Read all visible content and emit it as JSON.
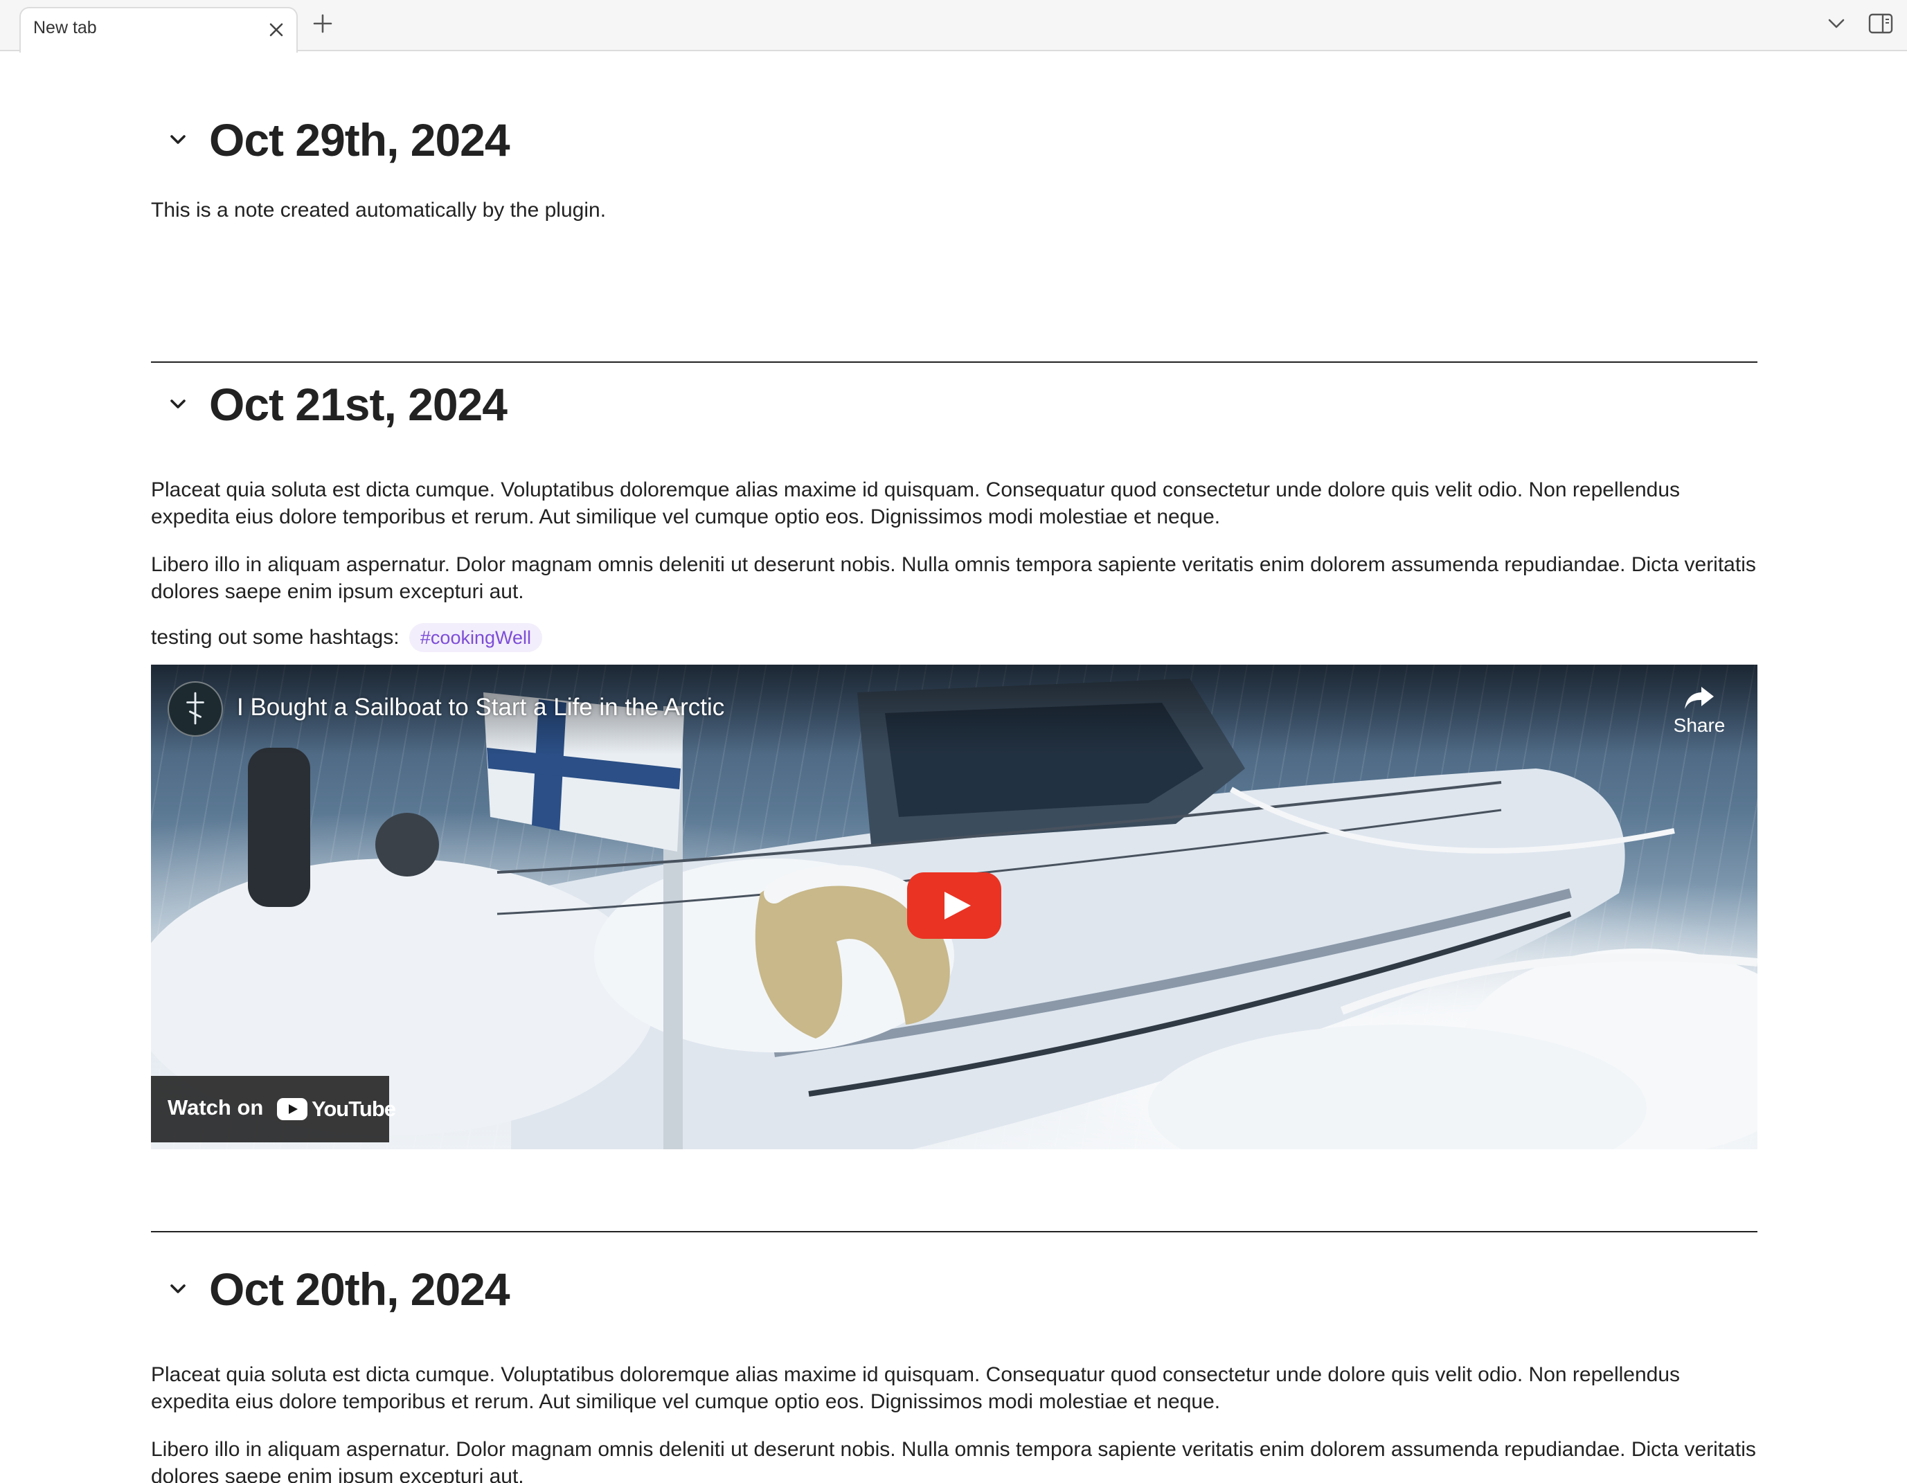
{
  "tabbar": {
    "tab_title": "New tab",
    "icons": {
      "close": "close-icon",
      "new_tab": "plus-icon",
      "tab_list": "chevron-down-icon",
      "sidebar": "sidebar-toggle-icon"
    }
  },
  "journals": [
    {
      "title": "Oct 29th, 2024",
      "paragraphs": [
        "This is a note created automatically by the plugin."
      ]
    },
    {
      "title": "Oct 21st, 2024",
      "paragraphs": [
        "Placeat quia soluta est dicta cumque. Voluptatibus doloremque alias maxime id quisquam. Consequatur quod consectetur unde dolore quis velit odio. Non repellendus expedita eius dolore temporibus et rerum. Aut similique vel cumque optio eos. Dignissimos modi molestiae et neque.",
        "Libero illo in aliquam aspernatur. Dolor magnam omnis deleniti ut deserunt nobis. Nulla omnis tempora sapiente veritatis enim dolorem assumenda repudiandae. Dicta veritatis dolores saepe enim ipsum excepturi aut."
      ],
      "hashtag_line": {
        "text": "testing out some hashtags:",
        "tag": "#cookingWell"
      },
      "video": {
        "title": "I Bought a Sailboat to Start a Life in the Arctic",
        "share_label": "Share",
        "watch_on_label": "Watch on",
        "youtube_wordmark": "YouTube"
      }
    },
    {
      "title": "Oct 20th, 2024",
      "paragraphs": [
        "Placeat quia soluta est dicta cumque. Voluptatibus doloremque alias maxime id quisquam. Consequatur quod consectetur unde dolore quis velit odio. Non repellendus expedita eius dolore temporibus et rerum. Aut similique vel cumque optio eos. Dignissimos modi molestiae et neque.",
        "Libero illo in aliquam aspernatur. Dolor magnam omnis deleniti ut deserunt nobis. Nulla omnis tempora sapiente veritatis enim dolorem assumenda repudiandae. Dicta veritatis dolores saepe enim ipsum excepturi aut."
      ]
    }
  ],
  "colors": {
    "tag_text": "#7c4dd8",
    "tag_background": "#f3eefb",
    "youtube_red": "#ea3323"
  }
}
